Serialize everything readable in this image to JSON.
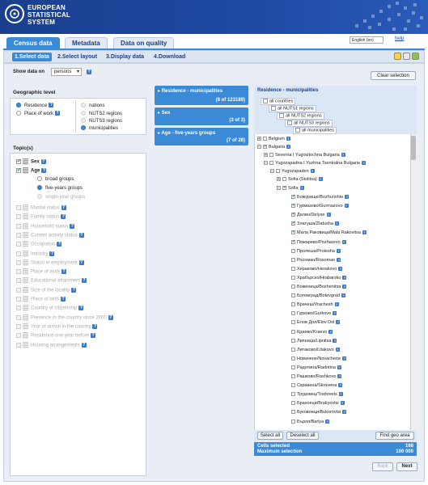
{
  "header": {
    "title_line1": "EUROPEAN",
    "title_line2": "STATISTICAL",
    "title_line3": "SYSTEM"
  },
  "tabs": [
    "Census data",
    "Metadata",
    "Data on quality"
  ],
  "language": "English (en)",
  "help": "help",
  "steps": [
    "1.Select data",
    "2.Select layout",
    "3.Display data",
    "4.Download"
  ],
  "show_data": {
    "label": "Show data on",
    "value": "persons"
  },
  "clear_selection": "Clear selection",
  "geo_level": {
    "title": "Geographic level",
    "left": [
      "Residence",
      "Place of work"
    ],
    "right": [
      "nations",
      "NUTS2 regions",
      "NUTS3 regions",
      "municipalities"
    ]
  },
  "topics": {
    "title": "Topic(s)",
    "sex": "Sex",
    "age": "Age",
    "age_groups": [
      "broad groups",
      "five-years groups",
      "single-year groups"
    ],
    "others": [
      "Marital status",
      "Family status",
      "Household status",
      "Current activity status",
      "Occupation",
      "Industry",
      "Status in employment",
      "Place of work",
      "Educational attainment",
      "Size of the locality",
      "Place of birth",
      "Country of citizenship",
      "Presence in the country since 2000",
      "Year of arrival in the country",
      "Residence one year before",
      "Housing arrangements"
    ]
  },
  "summaries": [
    {
      "title": "Residence - municipalities",
      "count": "(8 of 123189)"
    },
    {
      "title": "Sex",
      "count": "(3 of 3)"
    },
    {
      "title": "Age - five-years groups",
      "count": "(7 of 28)"
    }
  ],
  "geo_panel": {
    "title": "Residence - municipalities",
    "levels": [
      "all countries",
      "all NUTS1 regions",
      "all NUTS2 regions",
      "all NUTS3 regions",
      "all municipalities"
    ],
    "tree": {
      "belgium": "Belgium",
      "bulgaria": "Bulgaria",
      "severna": "Severna I Yugoiztochna Bulgaria",
      "yugozapadna": "Yugozapadna I Yuzhna Tsentralna Bulgaria",
      "yugozapaden": "Yugozapaden",
      "sofia_stolitsa": "Sofia (Stolitsa)",
      "sofia": "Sofia",
      "municipalities": [
        {
          "name": "Божурище/Bozhurishte",
          "checked": true
        },
        {
          "name": "Гурмазово/Gurmazovo",
          "checked": true
        },
        {
          "name": "Делин/Delyan",
          "checked": true
        },
        {
          "name": "Златуша/Zlatusha",
          "checked": true
        },
        {
          "name": "Мала Раковица/Mala Rakovitsa",
          "checked": true
        },
        {
          "name": "Пожарево/Pozharevo",
          "checked": true
        },
        {
          "name": "Пролеша/Prolesha",
          "checked": false
        },
        {
          "name": "Росоман/Rosoman",
          "checked": false
        },
        {
          "name": "Хераково/Herakovo",
          "checked": false
        },
        {
          "name": "Храбърско/Hrabarsko",
          "checked": false
        },
        {
          "name": "Боженица/Bozhenitsa",
          "checked": false
        },
        {
          "name": "Ботевград/Botevgrad",
          "checked": false
        },
        {
          "name": "Врачеш/Vrachesh",
          "checked": false
        },
        {
          "name": "Гурково/Gurkovo",
          "checked": false
        },
        {
          "name": "Елов Дол/Elov Dol",
          "checked": false
        },
        {
          "name": "Краево/Kraevo",
          "checked": false
        },
        {
          "name": "Липница/Lipnitsa",
          "checked": false
        },
        {
          "name": "Литаково/Litakovo",
          "checked": false
        },
        {
          "name": "Новачене/Novachene",
          "checked": false
        },
        {
          "name": "Радотина/Radotina",
          "checked": false
        },
        {
          "name": "Рашково/Rashkovo",
          "checked": false
        },
        {
          "name": "Скравена/Skravena",
          "checked": false
        },
        {
          "name": "Трудовец/Trudovets",
          "checked": false
        },
        {
          "name": "Брахоеци/Brakyovtsi",
          "checked": false
        },
        {
          "name": "Буковоици/Bukorovtsi",
          "checked": false
        },
        {
          "name": "Бърля/Barlya",
          "checked": false
        }
      ]
    },
    "select_all": "Select all",
    "deselect_all": "Deselect all",
    "find_geo": "Find geo area",
    "cells_selected_label": "Cells selected",
    "cells_selected": "168",
    "max_selection_label": "Maximum selection",
    "max_selection": "100 000"
  },
  "nav": {
    "back": "Back",
    "next": "Next"
  }
}
